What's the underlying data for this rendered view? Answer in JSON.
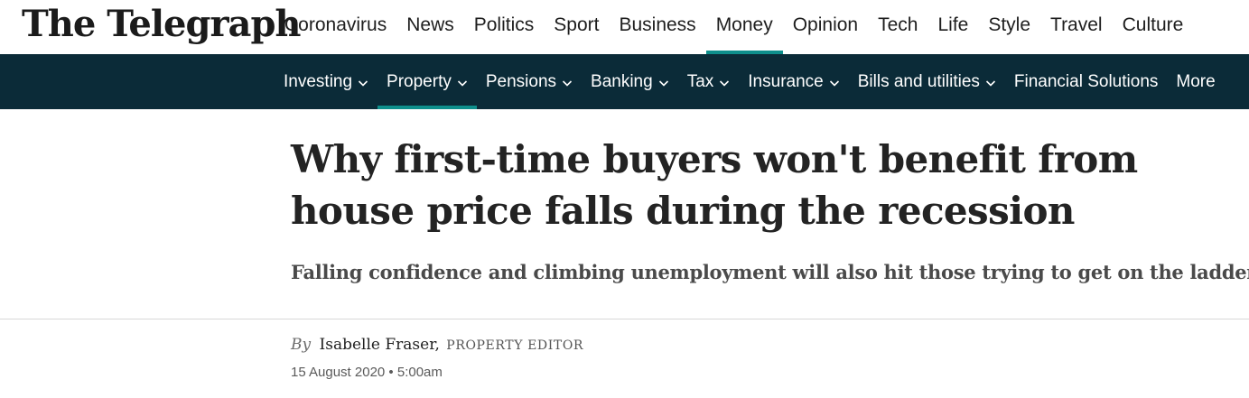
{
  "brand": {
    "logo_text": "The Telegraph"
  },
  "primary_nav": {
    "items": [
      {
        "label": "Coronavirus"
      },
      {
        "label": "News"
      },
      {
        "label": "Politics"
      },
      {
        "label": "Sport"
      },
      {
        "label": "Business"
      },
      {
        "label": "Money"
      },
      {
        "label": "Opinion"
      },
      {
        "label": "Tech"
      },
      {
        "label": "Life"
      },
      {
        "label": "Style"
      },
      {
        "label": "Travel"
      },
      {
        "label": "Culture"
      }
    ],
    "active": "Money"
  },
  "secondary_nav": {
    "items": [
      {
        "label": "Investing"
      },
      {
        "label": "Property"
      },
      {
        "label": "Pensions"
      },
      {
        "label": "Banking"
      },
      {
        "label": "Tax"
      },
      {
        "label": "Insurance"
      },
      {
        "label": "Bills and utilities"
      },
      {
        "label": "Financial Solutions"
      },
      {
        "label": "More"
      }
    ],
    "active": "Property"
  },
  "article": {
    "headline": "Why first-time buyers won't benefit from house price falls during the recession",
    "standfirst": "Falling confidence and climbing unemployment will also hit those trying to get on the ladder",
    "byline_prefix": "By",
    "author": "Isabelle Fraser,",
    "author_role": "PROPERTY EDITOR",
    "date": "15 August 2020 • 5:00am"
  },
  "colors": {
    "accent": "#0e8f8c",
    "subnav_bg": "#0b2b38",
    "text": "#232323"
  }
}
